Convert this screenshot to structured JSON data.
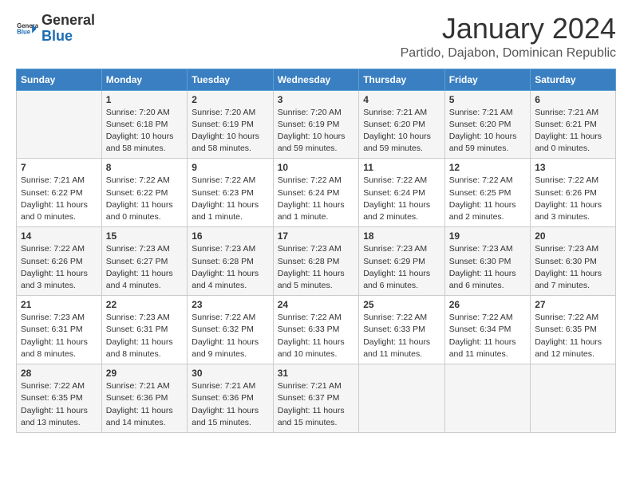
{
  "header": {
    "logo_general": "General",
    "logo_blue": "Blue",
    "title": "January 2024",
    "subtitle": "Partido, Dajabon, Dominican Republic"
  },
  "calendar": {
    "days_of_week": [
      "Sunday",
      "Monday",
      "Tuesday",
      "Wednesday",
      "Thursday",
      "Friday",
      "Saturday"
    ],
    "weeks": [
      [
        {
          "day": "",
          "info": ""
        },
        {
          "day": "1",
          "info": "Sunrise: 7:20 AM\nSunset: 6:18 PM\nDaylight: 10 hours\nand 58 minutes."
        },
        {
          "day": "2",
          "info": "Sunrise: 7:20 AM\nSunset: 6:19 PM\nDaylight: 10 hours\nand 58 minutes."
        },
        {
          "day": "3",
          "info": "Sunrise: 7:20 AM\nSunset: 6:19 PM\nDaylight: 10 hours\nand 59 minutes."
        },
        {
          "day": "4",
          "info": "Sunrise: 7:21 AM\nSunset: 6:20 PM\nDaylight: 10 hours\nand 59 minutes."
        },
        {
          "day": "5",
          "info": "Sunrise: 7:21 AM\nSunset: 6:20 PM\nDaylight: 10 hours\nand 59 minutes."
        },
        {
          "day": "6",
          "info": "Sunrise: 7:21 AM\nSunset: 6:21 PM\nDaylight: 11 hours\nand 0 minutes."
        }
      ],
      [
        {
          "day": "7",
          "info": "Sunrise: 7:21 AM\nSunset: 6:22 PM\nDaylight: 11 hours\nand 0 minutes."
        },
        {
          "day": "8",
          "info": "Sunrise: 7:22 AM\nSunset: 6:22 PM\nDaylight: 11 hours\nand 0 minutes."
        },
        {
          "day": "9",
          "info": "Sunrise: 7:22 AM\nSunset: 6:23 PM\nDaylight: 11 hours\nand 1 minute."
        },
        {
          "day": "10",
          "info": "Sunrise: 7:22 AM\nSunset: 6:24 PM\nDaylight: 11 hours\nand 1 minute."
        },
        {
          "day": "11",
          "info": "Sunrise: 7:22 AM\nSunset: 6:24 PM\nDaylight: 11 hours\nand 2 minutes."
        },
        {
          "day": "12",
          "info": "Sunrise: 7:22 AM\nSunset: 6:25 PM\nDaylight: 11 hours\nand 2 minutes."
        },
        {
          "day": "13",
          "info": "Sunrise: 7:22 AM\nSunset: 6:26 PM\nDaylight: 11 hours\nand 3 minutes."
        }
      ],
      [
        {
          "day": "14",
          "info": "Sunrise: 7:22 AM\nSunset: 6:26 PM\nDaylight: 11 hours\nand 3 minutes."
        },
        {
          "day": "15",
          "info": "Sunrise: 7:23 AM\nSunset: 6:27 PM\nDaylight: 11 hours\nand 4 minutes."
        },
        {
          "day": "16",
          "info": "Sunrise: 7:23 AM\nSunset: 6:28 PM\nDaylight: 11 hours\nand 4 minutes."
        },
        {
          "day": "17",
          "info": "Sunrise: 7:23 AM\nSunset: 6:28 PM\nDaylight: 11 hours\nand 5 minutes."
        },
        {
          "day": "18",
          "info": "Sunrise: 7:23 AM\nSunset: 6:29 PM\nDaylight: 11 hours\nand 6 minutes."
        },
        {
          "day": "19",
          "info": "Sunrise: 7:23 AM\nSunset: 6:30 PM\nDaylight: 11 hours\nand 6 minutes."
        },
        {
          "day": "20",
          "info": "Sunrise: 7:23 AM\nSunset: 6:30 PM\nDaylight: 11 hours\nand 7 minutes."
        }
      ],
      [
        {
          "day": "21",
          "info": "Sunrise: 7:23 AM\nSunset: 6:31 PM\nDaylight: 11 hours\nand 8 minutes."
        },
        {
          "day": "22",
          "info": "Sunrise: 7:23 AM\nSunset: 6:31 PM\nDaylight: 11 hours\nand 8 minutes."
        },
        {
          "day": "23",
          "info": "Sunrise: 7:22 AM\nSunset: 6:32 PM\nDaylight: 11 hours\nand 9 minutes."
        },
        {
          "day": "24",
          "info": "Sunrise: 7:22 AM\nSunset: 6:33 PM\nDaylight: 11 hours\nand 10 minutes."
        },
        {
          "day": "25",
          "info": "Sunrise: 7:22 AM\nSunset: 6:33 PM\nDaylight: 11 hours\nand 11 minutes."
        },
        {
          "day": "26",
          "info": "Sunrise: 7:22 AM\nSunset: 6:34 PM\nDaylight: 11 hours\nand 11 minutes."
        },
        {
          "day": "27",
          "info": "Sunrise: 7:22 AM\nSunset: 6:35 PM\nDaylight: 11 hours\nand 12 minutes."
        }
      ],
      [
        {
          "day": "28",
          "info": "Sunrise: 7:22 AM\nSunset: 6:35 PM\nDaylight: 11 hours\nand 13 minutes."
        },
        {
          "day": "29",
          "info": "Sunrise: 7:21 AM\nSunset: 6:36 PM\nDaylight: 11 hours\nand 14 minutes."
        },
        {
          "day": "30",
          "info": "Sunrise: 7:21 AM\nSunset: 6:36 PM\nDaylight: 11 hours\nand 15 minutes."
        },
        {
          "day": "31",
          "info": "Sunrise: 7:21 AM\nSunset: 6:37 PM\nDaylight: 11 hours\nand 15 minutes."
        },
        {
          "day": "",
          "info": ""
        },
        {
          "day": "",
          "info": ""
        },
        {
          "day": "",
          "info": ""
        }
      ]
    ]
  }
}
